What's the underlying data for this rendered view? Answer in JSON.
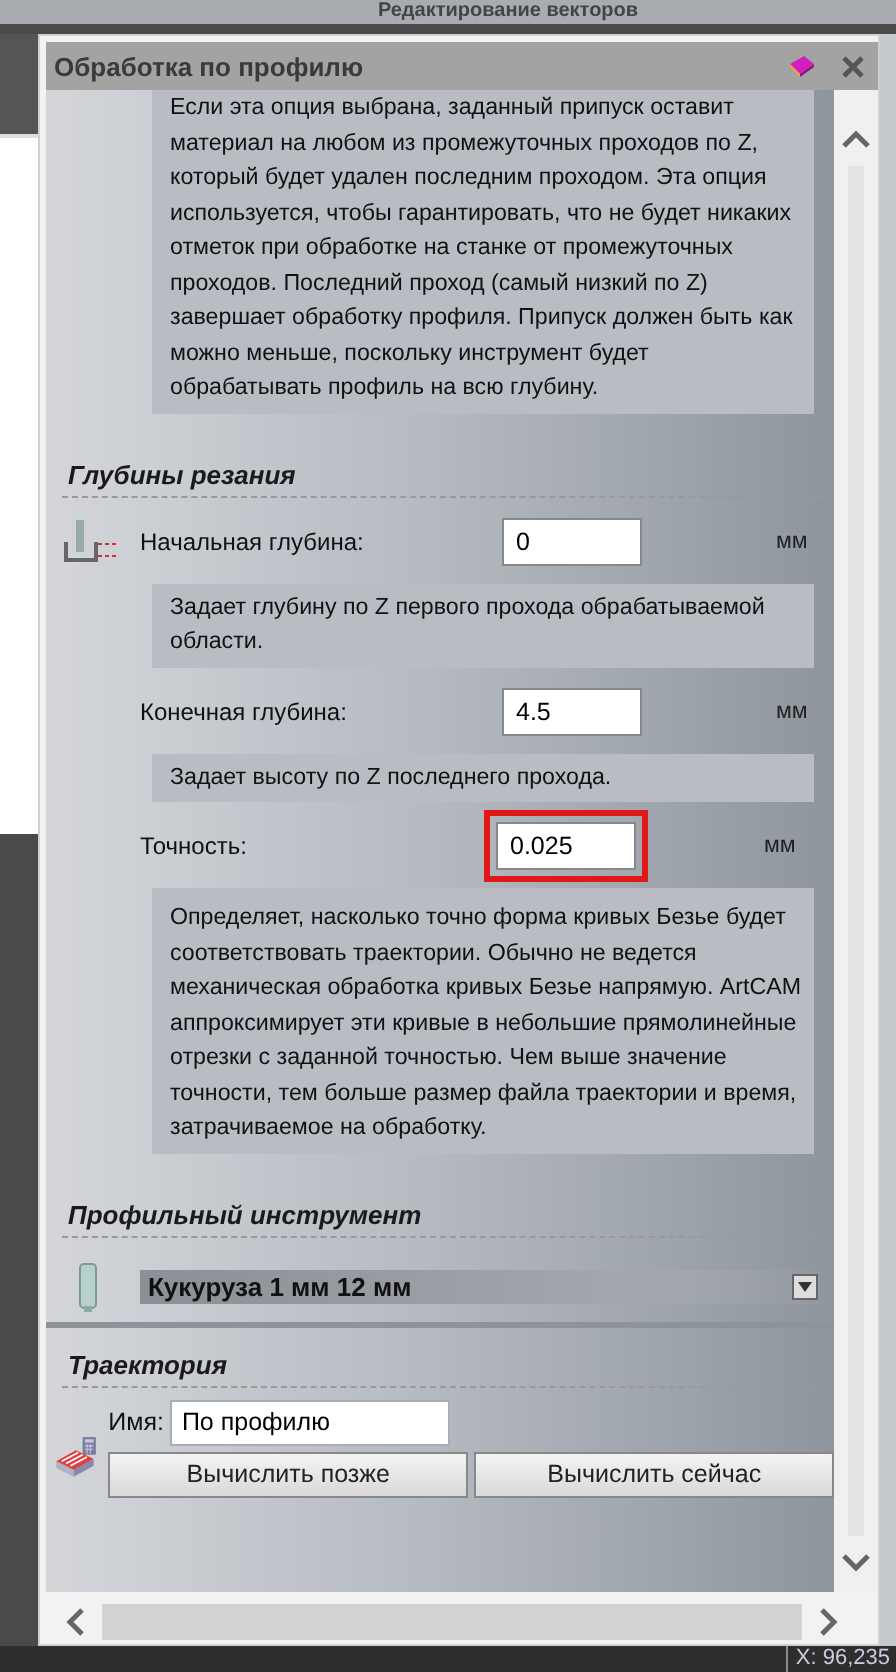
{
  "app_title": "Редактирование векторов",
  "panel": {
    "title": "Обработка по профилю",
    "intro_help": "Если эта опция выбрана, заданный припуск оставит материал на любом из промежуточных проходов по Z, который будет удален последним проходом. Эта опция используется, чтобы гарантировать, что не будет никаких отметок при обработке на станке от промежуточных проходов. Последний проход (самый низкий по Z) завершает обработку профиля. Припуск должен быть как можно меньше, поскольку инструмент будет обрабатывать профиль на всю глубину.",
    "depth_section": {
      "title": "Глубины резания",
      "fields": [
        {
          "label": "Начальная глубина:",
          "value": "0",
          "unit": "мм",
          "highlighted": false,
          "help": "Задает глубину по Z первого прохода обрабатываемой области."
        },
        {
          "label": "Конечная глубина:",
          "value": "4.5",
          "unit": "мм",
          "highlighted": false,
          "help": "Задает высоту по Z последнего прохода."
        },
        {
          "label": "Точность:",
          "value": "0.025",
          "unit": "мм",
          "highlighted": true,
          "help": "Определяет, насколько точно форма кривых Безье будет соответствовать траектории. Обычно не ведется механическая обработка кривых Безье напрямую. ArtCAM аппроксимирует эти кривые в небольшие прямолинейные отрезки с заданной точностью. Чем выше значение точности, тем больше размер файла траектории и время, затрачиваемое на обработку."
        }
      ]
    },
    "tool_section": {
      "title": "Профильный инструмент",
      "tool": "Кукуруза 1 мм 12 мм"
    },
    "toolpath_section": {
      "title": "Траектория",
      "name_label": "Имя:",
      "name_value": "По профилю",
      "buttons": [
        "Вычислить позже",
        "Вычислить сейчас"
      ]
    }
  },
  "status": "X: 96,235"
}
